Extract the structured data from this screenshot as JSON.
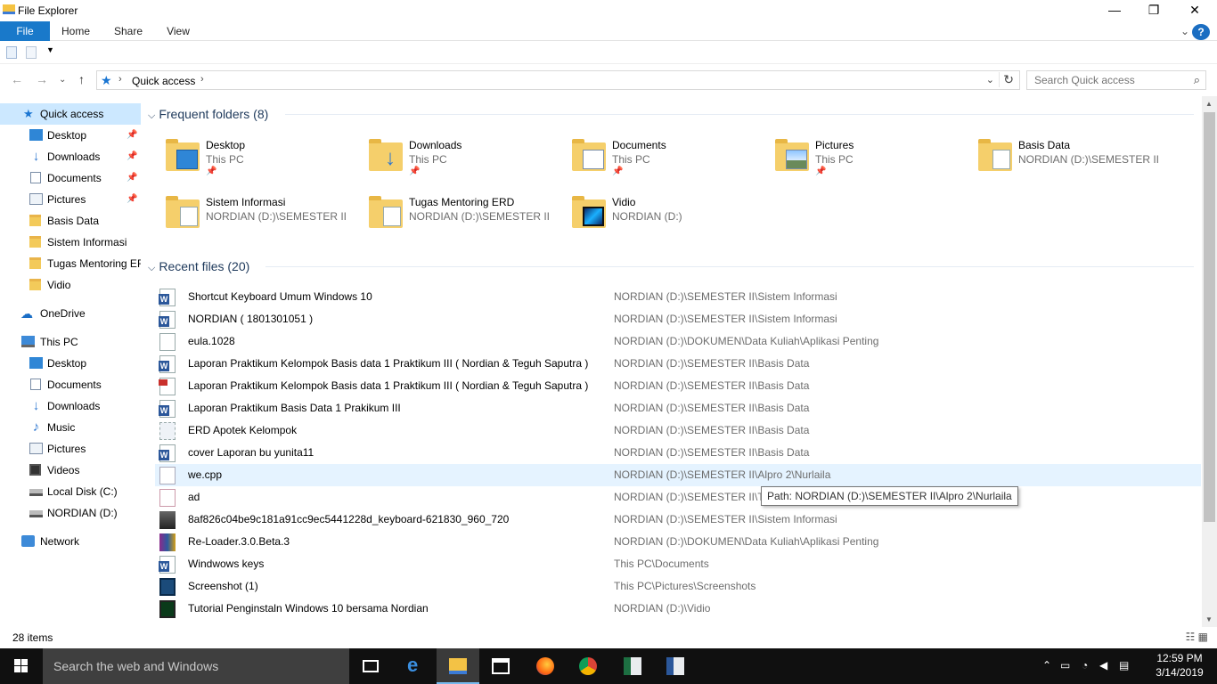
{
  "window": {
    "title": "File Explorer",
    "minimize": "—",
    "maximize": "❐",
    "close": "✕"
  },
  "ribbon": {
    "tabs": [
      "File",
      "Home",
      "Share",
      "View"
    ],
    "expand": "⌄"
  },
  "nav": {
    "back": "←",
    "forward": "→",
    "recent": "⌄",
    "up": "↑",
    "breadcrumb": "Quick access",
    "search_placeholder": "Search Quick access"
  },
  "sidebar": {
    "quick_access": "Quick access",
    "pinned": [
      {
        "label": "Desktop",
        "icon": "desktop-icon"
      },
      {
        "label": "Downloads",
        "icon": "downloads-icon"
      },
      {
        "label": "Documents",
        "icon": "documents-icon"
      },
      {
        "label": "Pictures",
        "icon": "pictures-icon"
      }
    ],
    "recent": [
      "Basis Data",
      "Sistem Informasi",
      "Tugas Mentoring ERD",
      "Vidio"
    ],
    "onedrive": "OneDrive",
    "this_pc": "This PC",
    "pc_items": [
      "Desktop",
      "Documents",
      "Downloads",
      "Music",
      "Pictures",
      "Videos",
      "Local Disk (C:)",
      "NORDIAN (D:)"
    ],
    "network": "Network"
  },
  "frequent": {
    "header": "Frequent folders (8)",
    "folders": [
      {
        "name": "Desktop",
        "location": "This PC",
        "pinned": true,
        "icon": "desktop-folder-icon"
      },
      {
        "name": "Downloads",
        "location": "This PC",
        "pinned": true,
        "icon": "downloads-folder-icon"
      },
      {
        "name": "Documents",
        "location": "This PC",
        "pinned": true,
        "icon": "documents-folder-icon"
      },
      {
        "name": "Pictures",
        "location": "This PC",
        "pinned": true,
        "icon": "pictures-folder-icon"
      },
      {
        "name": "Basis Data",
        "location": "NORDIAN (D:)\\SEMESTER II",
        "pinned": false,
        "icon": "folder-icon"
      },
      {
        "name": "Sistem Informasi",
        "location": "NORDIAN (D:)\\SEMESTER II",
        "pinned": false,
        "icon": "folder-icon"
      },
      {
        "name": "Tugas Mentoring ERD",
        "location": "NORDIAN (D:)\\SEMESTER II",
        "pinned": false,
        "icon": "folder-icon"
      },
      {
        "name": "Vidio",
        "location": "NORDIAN (D:)",
        "pinned": false,
        "icon": "video-folder-icon"
      }
    ]
  },
  "recent": {
    "header": "Recent files (20)",
    "files": [
      {
        "name": "Shortcut Keyboard Umum Windows 10",
        "path": "NORDIAN (D:)\\SEMESTER II\\Sistem Informasi",
        "type": "word"
      },
      {
        "name": "NORDIAN ( 1801301051 )",
        "path": "NORDIAN (D:)\\SEMESTER II\\Sistem Informasi",
        "type": "word"
      },
      {
        "name": "eula.1028",
        "path": "NORDIAN (D:)\\DOKUMEN\\Data Kuliah\\Aplikasi Penting",
        "type": "txt"
      },
      {
        "name": "Laporan Praktikum Kelompok Basis data 1 Praktikum III ( Nordian & Teguh Saputra )",
        "path": "NORDIAN (D:)\\SEMESTER II\\Basis Data",
        "type": "word"
      },
      {
        "name": "Laporan Praktikum Kelompok Basis data 1 Praktikum III ( Nordian & Teguh Saputra )",
        "path": "NORDIAN (D:)\\SEMESTER II\\Basis Data",
        "type": "pdf"
      },
      {
        "name": "Laporan Praktikum Basis Data 1 Prakikum III",
        "path": "NORDIAN (D:)\\SEMESTER II\\Basis Data",
        "type": "word"
      },
      {
        "name": "ERD Apotek Kelompok",
        "path": "NORDIAN (D:)\\SEMESTER II\\Basis Data",
        "type": "erd"
      },
      {
        "name": "cover Laporan bu yunita11",
        "path": "NORDIAN (D:)\\SEMESTER II\\Basis Data",
        "type": "word"
      },
      {
        "name": "we.cpp",
        "path": "NORDIAN (D:)\\SEMESTER II\\Alpro 2\\Nurlaila",
        "type": "blank"
      },
      {
        "name": "ad",
        "path": "NORDIAN (D:)\\SEMESTER II\\Tu",
        "type": "ad"
      },
      {
        "name": "8af826c04be9c181a91cc9ec5441228d_keyboard-621830_960_720",
        "path": "NORDIAN (D:)\\SEMESTER II\\Sistem Informasi",
        "type": "img"
      },
      {
        "name": "Re-Loader.3.0.Beta.3",
        "path": "NORDIAN (D:)\\DOKUMEN\\Data Kuliah\\Aplikasi Penting",
        "type": "rar"
      },
      {
        "name": "Windwows keys",
        "path": "This PC\\Documents",
        "type": "word"
      },
      {
        "name": "Screenshot (1)",
        "path": "This PC\\Pictures\\Screenshots",
        "type": "shot"
      },
      {
        "name": "Tutorial Penginstaln Windows 10 bersama Nordian",
        "path": "NORDIAN (D:)\\Vidio",
        "type": "vid"
      }
    ],
    "hover_index": 8
  },
  "tooltip": "Path: NORDIAN (D:)\\SEMESTER II\\Alpro 2\\Nurlaila",
  "status": {
    "count": "28 items"
  },
  "taskbar": {
    "search": "Search the web and Windows",
    "apps": [
      "task-view-icon",
      "edge-icon",
      "file-explorer-icon",
      "store-icon",
      "firefox-icon",
      "chrome-icon",
      "excel-icon",
      "word-icon"
    ],
    "time": "12:59 PM",
    "date": "3/14/2019"
  },
  "colors": {
    "accent": "#1979ca",
    "selection": "#cce8ff",
    "hover": "#e5f3ff",
    "header": "#1e395b",
    "taskbar": "#101010"
  }
}
